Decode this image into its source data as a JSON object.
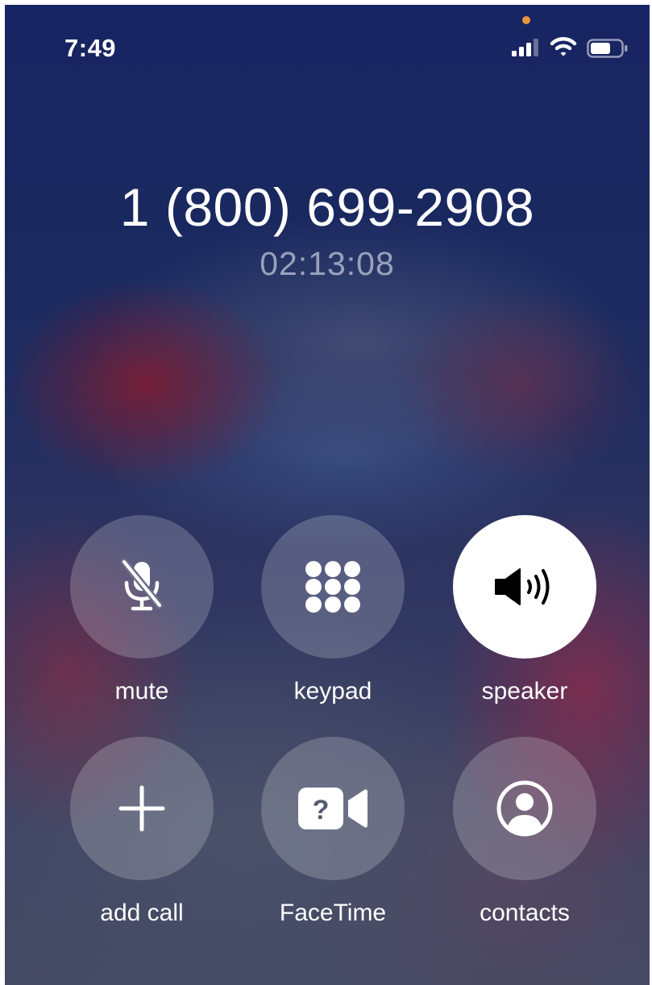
{
  "status_bar": {
    "time": "7:49",
    "icons": [
      "signal-icon",
      "wifi-icon",
      "battery-icon"
    ],
    "privacy_indicator_color": "#e8963a"
  },
  "call": {
    "number": "1 (800) 699-2908",
    "duration": "02:13:08"
  },
  "controls": [
    {
      "id": "mute",
      "label": "mute",
      "icon": "mic-slash-icon",
      "active": false
    },
    {
      "id": "keypad",
      "label": "keypad",
      "icon": "keypad-icon",
      "active": false
    },
    {
      "id": "speaker",
      "label": "speaker",
      "icon": "speaker-icon",
      "active": true
    },
    {
      "id": "add-call",
      "label": "add call",
      "icon": "plus-icon",
      "active": false
    },
    {
      "id": "facetime",
      "label": "FaceTime",
      "icon": "facetime-unavailable-icon",
      "active": false
    },
    {
      "id": "contacts",
      "label": "contacts",
      "icon": "contact-icon",
      "active": false
    }
  ]
}
